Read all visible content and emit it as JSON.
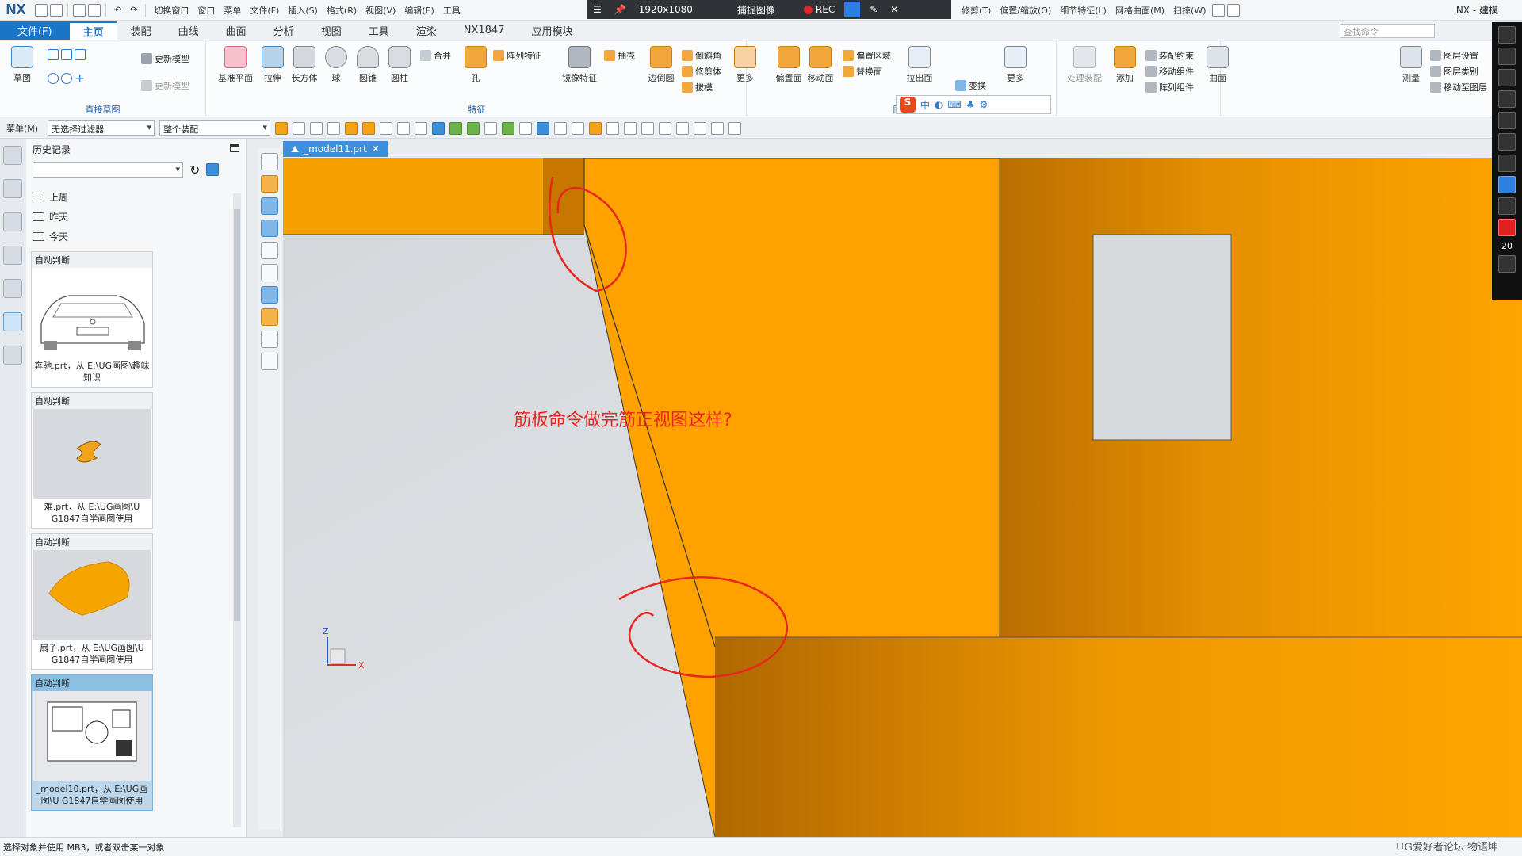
{
  "app": {
    "logo": "NX",
    "window_title": "NX - 建模"
  },
  "quick_access": {
    "items": [
      "切换窗口",
      "窗口",
      "菜单",
      "文件(F)",
      "插入(S)",
      "格式(R)",
      "视图(V)",
      "编辑(E)",
      "工具",
      "修剪(T)",
      "偏置/缩放(O)",
      "细节特征(L)",
      "网格曲面(M)",
      "扫掠(W)"
    ]
  },
  "recorder": {
    "resolution": "1920x1080",
    "capture_label": "捕捉图像",
    "rec_label": "REC"
  },
  "ribbon": {
    "tabs": [
      "文件(F)",
      "主页",
      "装配",
      "曲线",
      "曲面",
      "分析",
      "视图",
      "工具",
      "渲染",
      "NX1847",
      "应用模块"
    ],
    "active_tab": "主页",
    "search_placeholder": "查找命令",
    "groups": {
      "sketch": {
        "label": "直接草图",
        "big": "草图",
        "small": [
          "更新模型",
          "更新模型"
        ]
      },
      "feature": {
        "label": "特征",
        "big": [
          "基准平面",
          "拉伸",
          "长方体",
          "球",
          "圆锥",
          "圆柱",
          "孔",
          "镜像特征",
          "边倒圆",
          "更多"
        ],
        "small": [
          "合并",
          "阵列特征",
          "抽壳",
          "倒斜角",
          "修剪体",
          "拔模"
        ]
      },
      "sync": {
        "label": "同步建模",
        "big": [
          "偏置面",
          "移动面",
          "拉出面",
          "变换",
          "更多"
        ],
        "small": [
          "偏置区域",
          "替换面"
        ]
      },
      "assembly": {
        "big": [
          "处理装配",
          "添加"
        ],
        "small": [
          "装配约束",
          "移动组件",
          "阵列组件"
        ]
      },
      "surface": {
        "big": [
          "曲面"
        ]
      },
      "measure": {
        "big": [
          "测量"
        ],
        "small": [
          "图层设置",
          "图层类别",
          "移动至图层"
        ]
      }
    }
  },
  "selection_bar": {
    "menu_label": "菜单(M)",
    "filter": "无选择过滤器",
    "scope": "整个装配"
  },
  "history": {
    "title": "历史记录",
    "folders": [
      "上周",
      "昨天",
      "今天"
    ],
    "cards": [
      {
        "caption": "自动判断",
        "desc": "奔驰.prt，从 E:\\UG画图\\趣味知识"
      },
      {
        "caption": "自动判断",
        "desc": "难.prt，从 E:\\UG画图\\U G1847自学画图使用"
      },
      {
        "caption": "自动判断",
        "desc": "扇子.prt，从 E:\\UG画图\\U G1847自学画图使用"
      },
      {
        "caption": "自动判断",
        "desc": "_model10.prt，从 E:\\UG画图\\U G1847自学画图使用"
      }
    ]
  },
  "document": {
    "tab_label": "_model11.prt",
    "close_symbol": "✕"
  },
  "viewport": {
    "annotation_text": "筋板命令做完筋正视图这样?",
    "annotation_color": "#e8261e",
    "model_color": "#f9a100",
    "axis_z": "Z",
    "axis_x": "X"
  },
  "annotation_toolbar": {
    "line_width": "20",
    "pen_color": "#e32020"
  },
  "status": {
    "message": "选择对象并使用 MB3，或者双击某一对象",
    "watermark": "UG爱好者论坛 物语坤"
  }
}
